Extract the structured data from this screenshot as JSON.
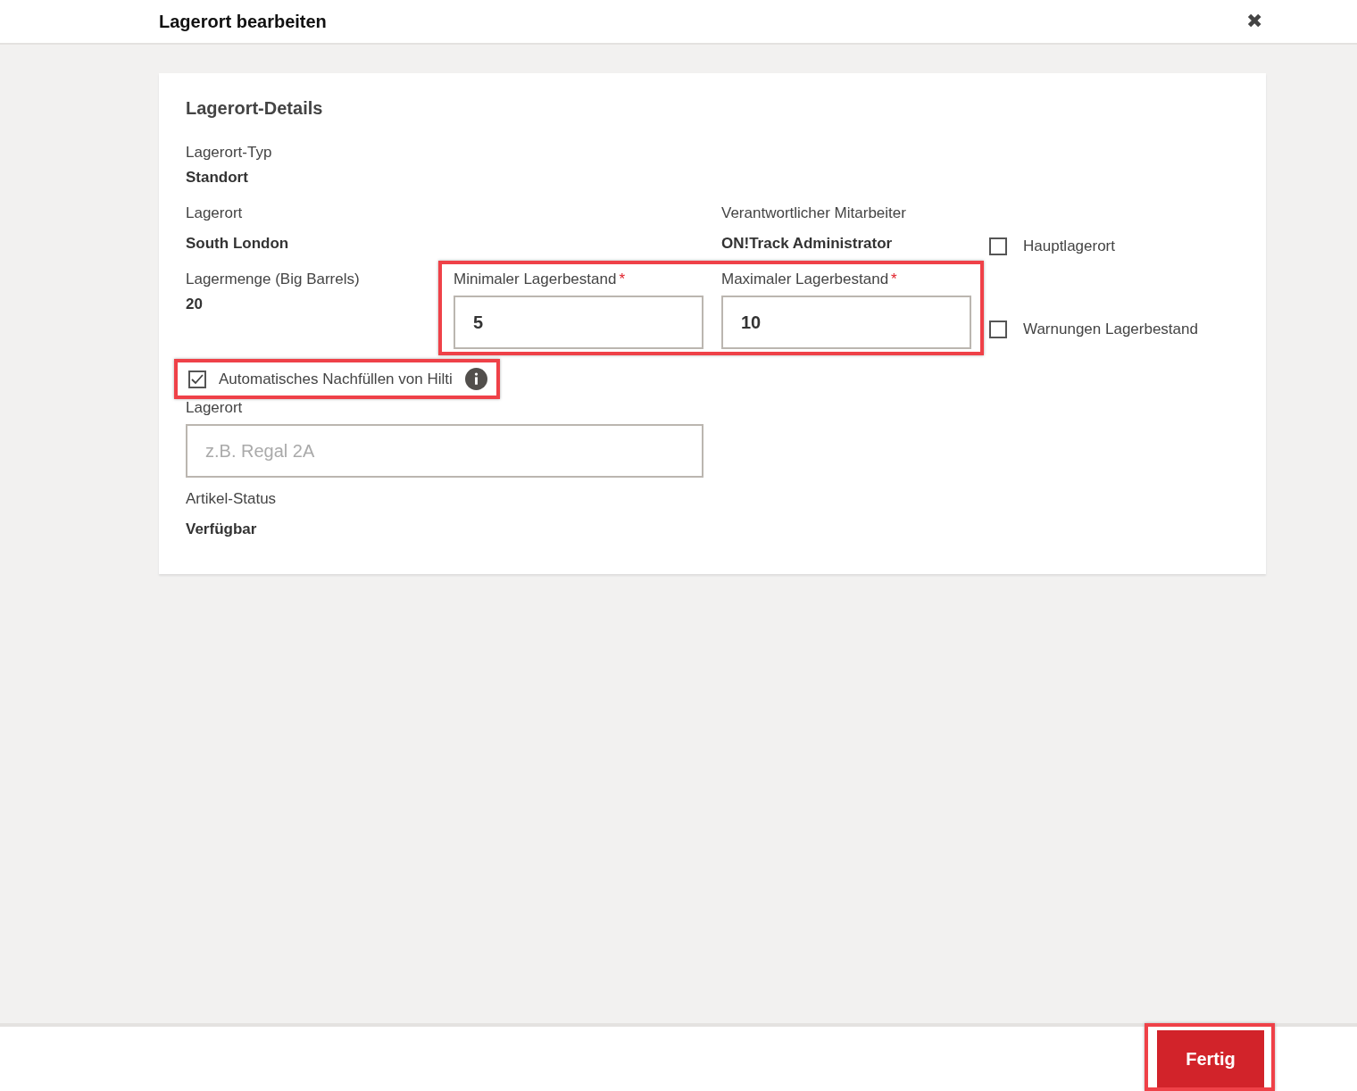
{
  "dialog": {
    "title": "Lagerort bearbeiten",
    "close": "✖"
  },
  "section": {
    "title": "Lagerort-Details",
    "location_type": {
      "label": "Lagerort-Typ",
      "value": "Standort"
    },
    "location": {
      "label": "Lagerort",
      "value": "South London"
    },
    "employee": {
      "label": "Verantwortlicher Mitarbeiter",
      "value": "ON!Track Administrator"
    },
    "main_location": {
      "label": "Hauptlagerort",
      "checked": false
    },
    "quantity": {
      "label": "Lagermenge (Big Barrels)",
      "value": "20"
    },
    "stock_fields": {
      "highlighted": true,
      "fields": [
        {
          "label": "Minimaler Lagerbestand",
          "required": "*",
          "value": "5"
        },
        {
          "label": "Maximaler Lagerbestand",
          "required": "*",
          "value": "10"
        }
      ]
    },
    "stock_warnings": {
      "label": "Warnungen Lagerbestand",
      "checked": false
    },
    "auto_refill": {
      "label": "Automatisches Nachfüllen von Hilti",
      "checked": true,
      "highlighted": true
    },
    "storage": {
      "label": "Lagerort",
      "placeholder": "z.B. Regal 2A"
    },
    "item_status": {
      "label": "Artikel-Status",
      "value": "Verfügbar"
    }
  },
  "footer": {
    "button": {
      "label": "Fertig",
      "highlighted": true
    }
  }
}
